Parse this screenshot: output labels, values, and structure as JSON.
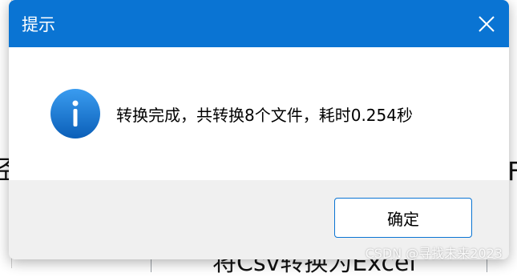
{
  "dialog": {
    "title": "提示",
    "close_icon": "close-icon",
    "info_icon": "info-icon",
    "message": "转换完成，共转换8个文件，耗时0.254秒",
    "ok_label": "确定",
    "accent_color": "#0a74d3"
  },
  "background": {
    "left_fragment": "经",
    "right_fragment": "F",
    "bottom_fragment": "将Csv转换为Excel"
  },
  "watermark": "CSDN @寻找未来2023"
}
